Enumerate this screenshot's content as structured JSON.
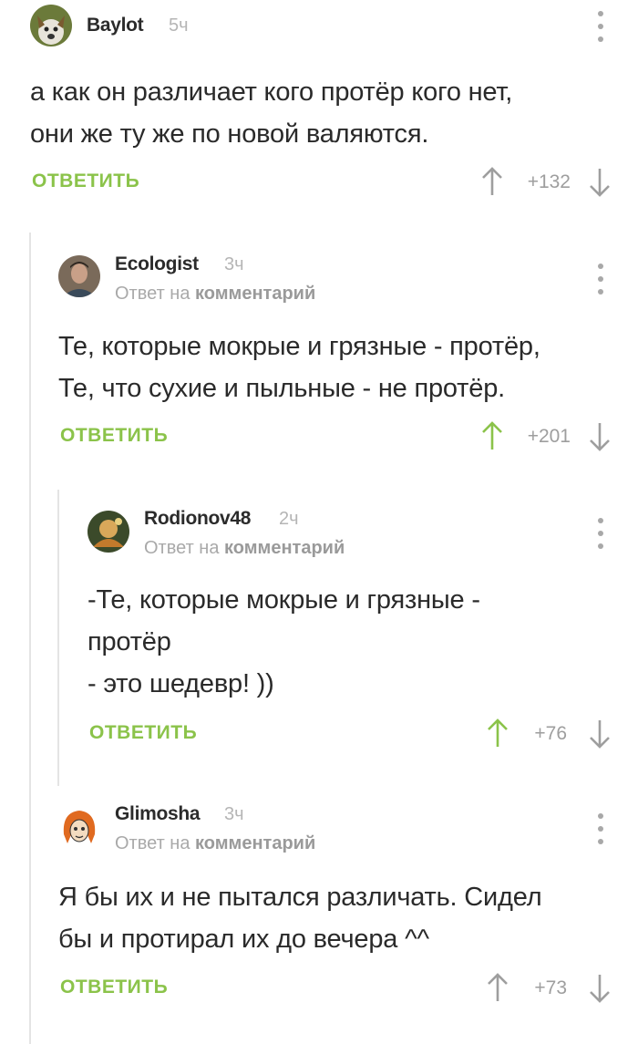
{
  "colors": {
    "accent_green": "#8bc34a",
    "username": "#2b2b2b",
    "muted": "#b5b5b5",
    "thread_line": "#e4e4e4"
  },
  "icons": [
    "avatar",
    "more-vert-icon",
    "arrow-up-icon",
    "arrow-down-icon"
  ],
  "comments": [
    {
      "author": "Baylot",
      "time": "5ч",
      "reply_prefix": "",
      "reply_link": "",
      "text": "а как он различает кого протёр кого нет,\nони же ту же по новой валяются.",
      "reply_label": "ОТВЕТИТЬ",
      "rating": "+132",
      "upvoted": false
    },
    {
      "author": "Ecologist",
      "time": "3ч",
      "reply_prefix": "Ответ на",
      "reply_link": "комментарий",
      "text": "Те, которые мокрые и грязные - протёр,\nТе, что сухие и пыльные - не протёр.",
      "reply_label": "ОТВЕТИТЬ",
      "rating": "+201",
      "upvoted": true
    },
    {
      "author": "Rodionov48",
      "time": "2ч",
      "reply_prefix": "Ответ на",
      "reply_link": "комментарий",
      "text": "-Те, которые мокрые и грязные -\nпротёр\n- это шедевр! ))",
      "reply_label": "ОТВЕТИТЬ",
      "rating": "+76",
      "upvoted": true
    },
    {
      "author": "Glimosha",
      "time": "3ч",
      "reply_prefix": "Ответ на",
      "reply_link": "комментарий",
      "text": "Я бы их и не пытался различать. Сидел\nбы и протирал их до вечера ^^",
      "reply_label": "ОТВЕТИТЬ",
      "rating": "+73",
      "upvoted": false
    }
  ]
}
